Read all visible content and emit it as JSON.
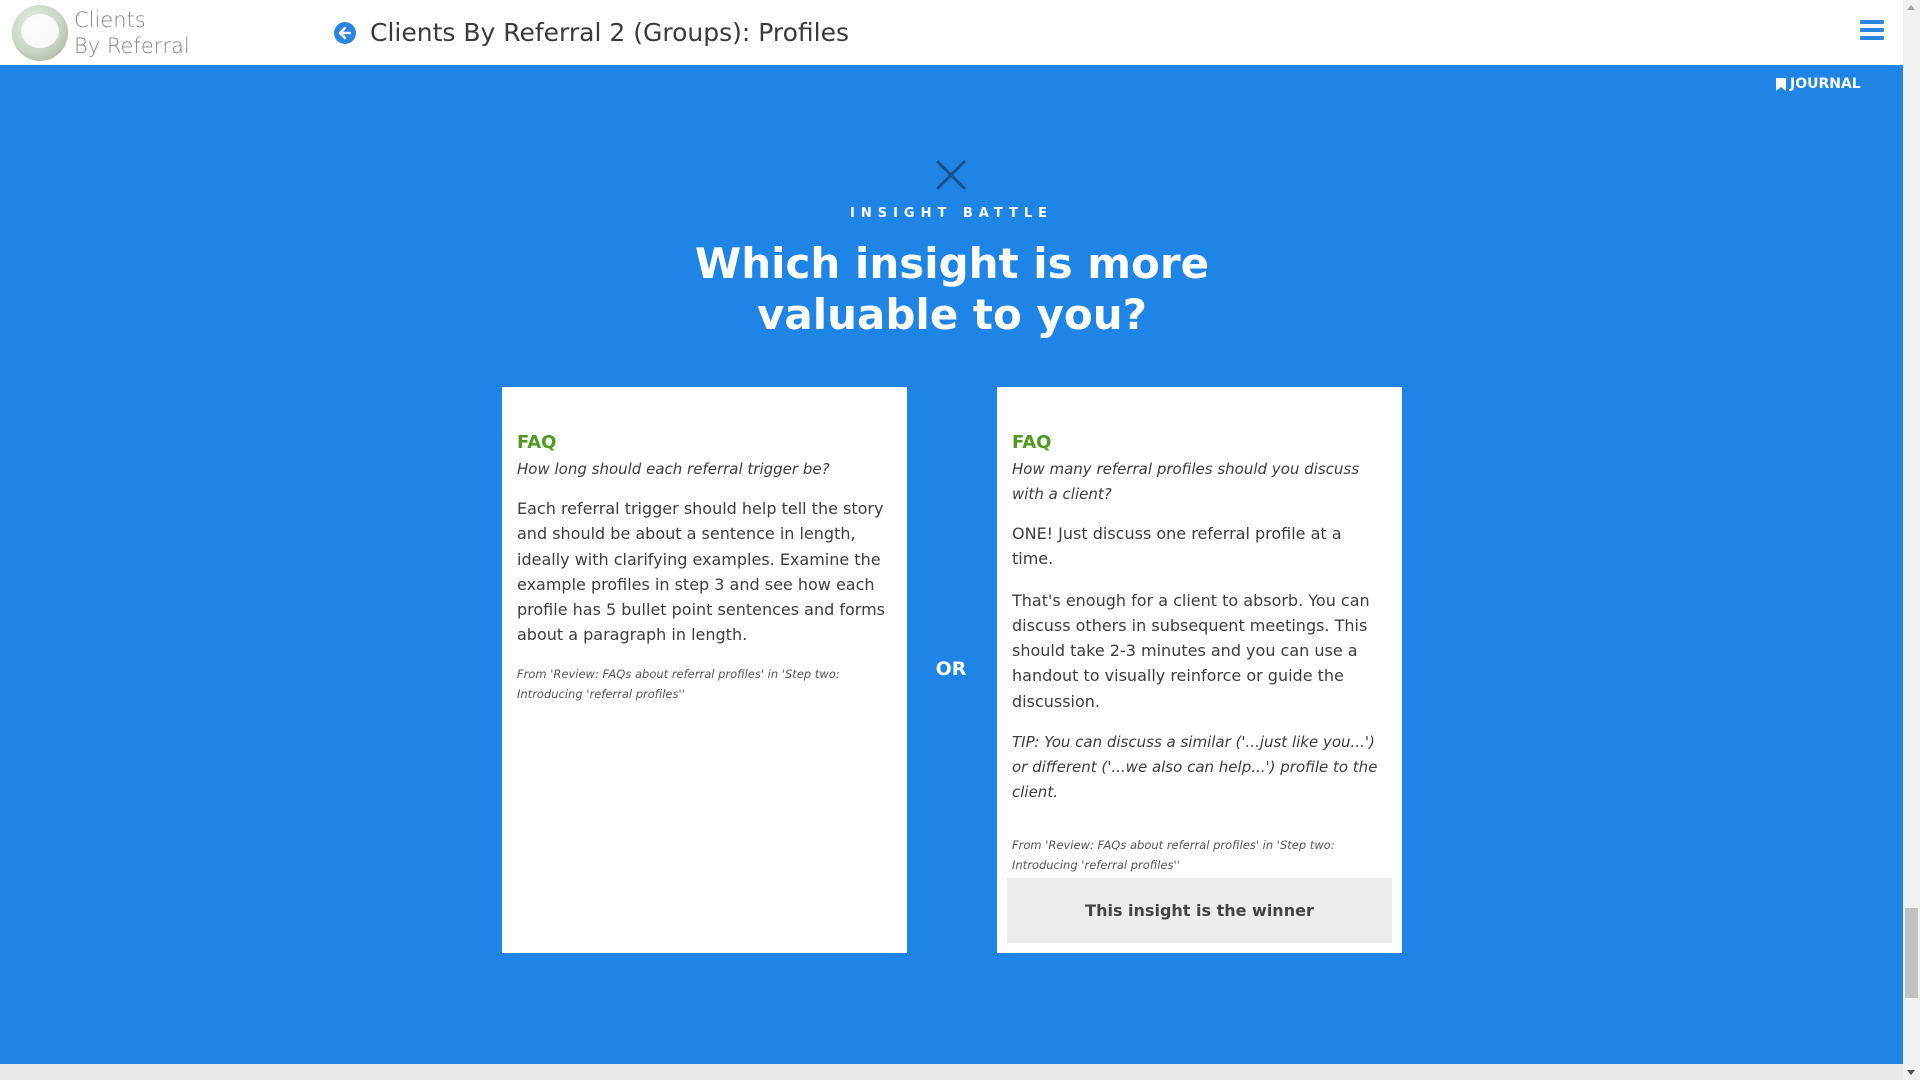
{
  "header": {
    "logo_line1": "Clients",
    "logo_line2": "By Referral",
    "title": "Clients By Referral 2 (Groups): Profiles",
    "back_icon": "arrow-left-circle-icon",
    "menu_icon": "hamburger-icon"
  },
  "journal": {
    "label": "JOURNAL",
    "icon": "bookmark-icon"
  },
  "battle": {
    "close_icon": "close-icon",
    "kicker": "INSIGHT BATTLE",
    "heading": "Which insight is more valuable to you?",
    "or_label": "OR"
  },
  "cards": [
    {
      "label": "FAQ",
      "question": "How long should each referral trigger be?",
      "paragraphs": [
        "Each referral trigger should help tell the story and should be about a sentence in length, ideally with clarifying examples. Examine the example profiles in step 3 and see how each profile has 5 bullet point sentences and forms about a paragraph in length."
      ],
      "source": "From 'Review: FAQs about referral profiles' in 'Step two: Introducing 'referral profiles''"
    },
    {
      "label": "FAQ",
      "question": "How many referral profiles should you discuss with a client?",
      "paragraphs": [
        "ONE! Just discuss one referral profile at a time.",
        "That's enough for a client to absorb. You can discuss others in subsequent meetings. This should take 2-3 minutes and you can use a handout to visually reinforce or guide the discussion."
      ],
      "tip": "TIP: You can discuss a similar ('...just like you...') or different ('...we also can help...') profile to the client.",
      "source": "From 'Review: FAQs about referral profiles' in 'Step two: Introducing 'referral profiles''",
      "winner_button": "This insight is the winner"
    }
  ],
  "colors": {
    "background": "#1e84e6",
    "accent": "#2a86e0",
    "faq_green": "#4f9a1e"
  }
}
